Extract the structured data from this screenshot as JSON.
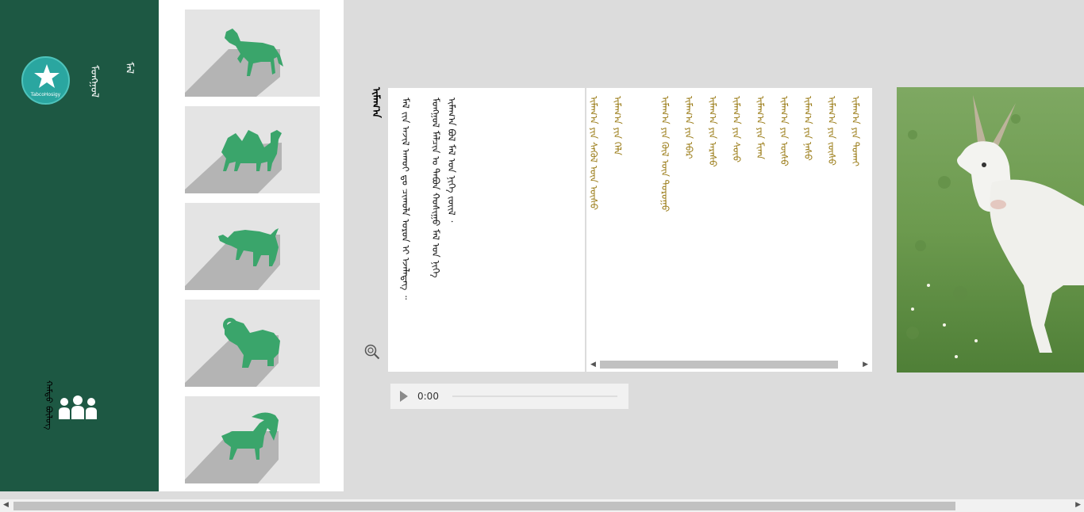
{
  "sidebar": {
    "logo_text": "TabcoHosigy",
    "app_title": "ᠮᠣᠩᠭᠣᠯ",
    "app_subtitle": "ᠮᠠᠯ",
    "group_label": "ᠬᠠᠮᠲᠤ ᠪᠦᠯᠦᠭ"
  },
  "thumbnails": [
    {
      "name": "horse",
      "icon": "horse-icon"
    },
    {
      "name": "camel",
      "icon": "camel-icon"
    },
    {
      "name": "cattle",
      "icon": "bull-icon"
    },
    {
      "name": "sheep",
      "icon": "ram-icon"
    },
    {
      "name": "goat",
      "icon": "goat-icon"
    }
  ],
  "content": {
    "title": "ᠢᠮᠠᠭ᠎ᠠ",
    "text_columns": [
      "ᠢᠮᠠᠭ᠎ᠠ ᠪᠣᠯ ᠮᠠᠯ ᠤᠨ ᠨᠢᠭᠡ ᠵᠦᠢᠯ ᠂",
      "ᠮᠣᠩᠭᠣᠯ ᠮᠠᠯᠴᠢᠨ ᠤ ᠲᠠᠪᠤᠨ ᠬᠣᠰᠢᠭᠤ ᠮᠠᠯ ᠤᠨ ᠨᠢᠭᠡ",
      "ᠮᠠᠯ ᠵᠢᠨ ᠠᠵᠢᠯ ᠠᠬᠤᠢ ᠳᠤ ᠴᠢᠬᠤᠯᠠ ᠤᠷᠤᠨ ᠢ ᠡᠵᠡᠯᠡᠳᠡᠭ ᠃"
    ],
    "list_items": [
      "ᠢᠮᠠᠭ᠎ᠠ ᠶᠢᠨ ᠲᠣᠬᠠᠢ",
      "ᠢᠮᠠᠭ᠎ᠠ ᠶᠢᠨ ᠵᠦᠰᠦ",
      "ᠢᠮᠠᠭ᠎ᠠ ᠶᠢᠨ ᠨᠠᠰᠤ",
      "ᠢᠮᠠᠭ᠎ᠠ ᠶᠢᠨ ᠦᠰᠦ",
      "ᠢᠮᠠᠭ᠎ᠠ ᠶᠢᠨ ᠮᠢᠬᠠ",
      "ᠢᠮᠠᠭ᠎ᠠ ᠶᠢᠨ ᠰᠦᠦ",
      "ᠢᠮᠠᠭ᠎ᠠ ᠶᠢᠨ ᠠᠷᠠᠰᠤ",
      "ᠢᠮᠠᠭ᠎ᠠ ᠶᠢᠨ ᠡᠪᠡᠷ",
      "ᠢᠮᠠᠭ᠎ᠠ ᠶᠢᠨ ᠬᠥᠯ ᠦᠨ ᠲᠤᠷᠤᠭᠤ",
      "ᠢᠮᠠᠭ᠎ᠠ ᠶᠢᠨ ᠬᠡᠯᠡ",
      "ᠢᠮᠠᠭ᠎ᠠ ᠶᠢᠨ ᠰᠡᠭᠦᠯ ᠦᠨ ᠦᠰᠦ"
    ]
  },
  "audio": {
    "time": "0:00",
    "progress": 0
  },
  "colors": {
    "sidebar": "#1d5843",
    "icon_green": "#3aa56b",
    "list_text": "#9a7b16",
    "logo_teal": "#2aa6a0"
  }
}
